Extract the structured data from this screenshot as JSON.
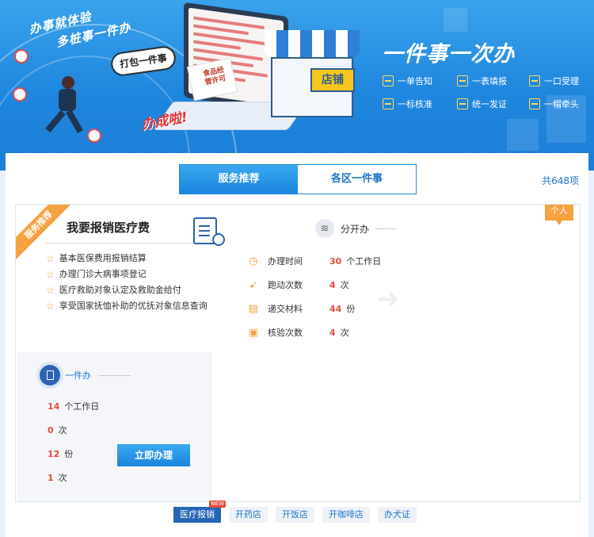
{
  "banner": {
    "slogan_line1": "办事就体验",
    "slogan_line2": "多桩事一件办",
    "bubble": "打包一件事",
    "done_text": "办成啦!",
    "shop_sign": "店铺",
    "box_label": "食品经营许可",
    "title": "一件事一次办",
    "features": [
      {
        "label": "一单告知",
        "icon": "notice-icon"
      },
      {
        "label": "一表填报",
        "icon": "form-icon"
      },
      {
        "label": "一口受理",
        "icon": "counter-icon"
      },
      {
        "label": "一标核准",
        "icon": "approve-icon"
      },
      {
        "label": "统一发证",
        "icon": "certificate-icon"
      },
      {
        "label": "一帽牵头",
        "icon": "lead-icon"
      }
    ]
  },
  "tabs": [
    {
      "label": "服务推荐",
      "active": true
    },
    {
      "label": "各区一件事",
      "active": false
    }
  ],
  "total_count": "共648项",
  "service": {
    "ribbon": "服务推荐",
    "personal_tag": "个人",
    "title": "我要报销医疗费",
    "items": [
      "基本医保费用报销结算",
      "办理门诊大病事项登记",
      "医疗救助对象认定及救助金给付",
      "享受国家抚恤补助的优抚对象信息查询"
    ]
  },
  "separate": {
    "label": "分开办",
    "stats": [
      {
        "icon": "clock-icon",
        "label": "办理时间",
        "value": "30",
        "unit": "个工作日"
      },
      {
        "icon": "running-icon",
        "label": "跑动次数",
        "value": "4",
        "unit": "次"
      },
      {
        "icon": "document-icon",
        "label": "递交材料",
        "value": "44",
        "unit": "份"
      },
      {
        "icon": "verify-icon",
        "label": "核验次数",
        "value": "4",
        "unit": "次"
      }
    ]
  },
  "one": {
    "label": "一件办",
    "stats": [
      {
        "value": "14",
        "unit": "个工作日"
      },
      {
        "value": "0",
        "unit": "次"
      },
      {
        "value": "12",
        "unit": "份"
      },
      {
        "value": "1",
        "unit": "次"
      }
    ],
    "apply_label": "立即办理"
  },
  "categories": [
    {
      "label": "医疗报销",
      "active": true,
      "badge": "NEW"
    },
    {
      "label": "开药店",
      "active": false
    },
    {
      "label": "开饭店",
      "active": false
    },
    {
      "label": "开咖啡店",
      "active": false
    },
    {
      "label": "办犬证",
      "active": false
    }
  ],
  "colors": {
    "brand_blue": "#1f86dd",
    "accent_orange": "#f5a241",
    "value_red": "#e64b3c"
  }
}
